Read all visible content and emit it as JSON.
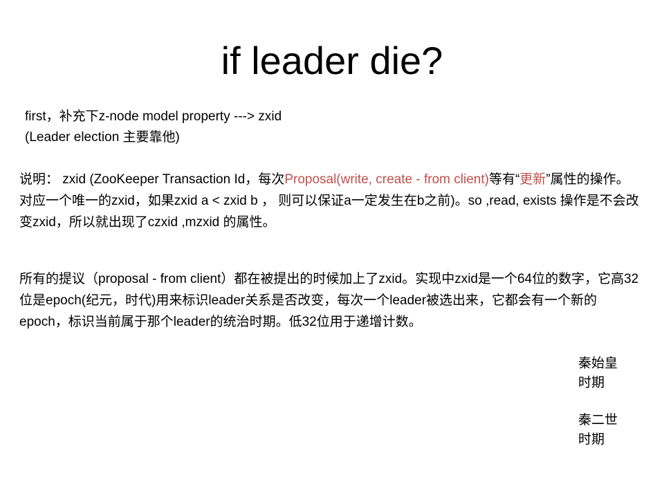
{
  "slide": {
    "title": "if  leader  die?",
    "intro": {
      "line1": "first，补充下z-node model property ---> zxid",
      "line2": "(Leader election 主要靠他)"
    },
    "para1": {
      "prefix": "说明：   zxid (ZooKeeper Transaction Id，每次",
      "highlight1": "Proposal(write, create - from client)",
      "mid": "等有“",
      "highlight2": "更新",
      "suffix": "”属性的操作。对应一个唯一的zxid，如果zxid a < zxid b ， 则可以保证a一定发生在b之前)。so ,read, exists 操作是不会改变zxid，所以就出现了czxid ,mzxid 的属性。"
    },
    "para2": {
      "text": "所有的提议（proposal - from client）都在被提出的时候加上了zxid。实现中zxid是一个64位的数字，它高32位是epoch(纪元，时代)用来标识leader关系是否改变，每次一个leader被选出来，它都会有一个新的epoch，标识当前属于那个leader的统治时期。低32位用于递增计数。"
    },
    "side_notes": [
      {
        "line1": "秦始皇",
        "line2": "时期"
      },
      {
        "line1": "秦二世",
        "line2": "时期"
      }
    ],
    "colors": {
      "highlight": "#c0504d",
      "text": "#000000",
      "background": "#ffffff"
    }
  }
}
